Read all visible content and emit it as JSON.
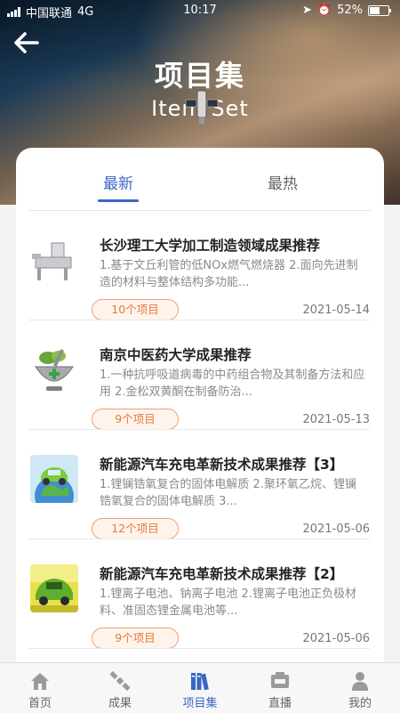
{
  "status_bar": {
    "carrier": "中国联通",
    "network": "4G",
    "time": "10:17",
    "battery": "52%",
    "battery_level": 0.52
  },
  "header": {
    "title": "项目集",
    "subtitle": "Item Set",
    "back_icon": "back-arrow-icon"
  },
  "tabs": [
    {
      "label": "最新",
      "active": true
    },
    {
      "label": "最热",
      "active": false
    }
  ],
  "items": [
    {
      "title": "长沙理工大学加工制造领域成果推荐",
      "desc": "1.基于文丘利管的低NOx燃气燃烧器 2.面向先进制造的材料与整体结构多功能...",
      "count": "10个项目",
      "date": "2021-05-14",
      "thumb": "machinery-thumbnail"
    },
    {
      "title": "南京中医药大学成果推荐",
      "desc": "1.一种抗呼吸道病毒的中药组合物及其制备方法和应用 2.金松双黄酮在制备防治...",
      "count": "9个项目",
      "date": "2021-05-13",
      "thumb": "herbal-mortar-thumbnail"
    },
    {
      "title": "新能源汽车充电革新技术成果推荐【3】",
      "desc": "1.锂镧锆氧复合的固体电解质 2.聚环氧乙烷、锂镧锆氧复合的固体电解质 3...",
      "count": "12个项目",
      "date": "2021-05-06",
      "thumb": "green-car-globe-thumbnail"
    },
    {
      "title": "新能源汽车充电革新技术成果推荐【2】",
      "desc": "1.锂离子电池、钠离子电池 2.锂离子电池正负极材料、准固态锂金属电池等...",
      "count": "9个项目",
      "date": "2021-05-06",
      "thumb": "grass-car-thumbnail"
    }
  ],
  "tabbar": [
    {
      "label": "首页",
      "icon": "home-icon",
      "active": false
    },
    {
      "label": "成果",
      "icon": "satellite-icon",
      "active": false
    },
    {
      "label": "项目集",
      "icon": "books-icon",
      "active": true
    },
    {
      "label": "直播",
      "icon": "live-camera-icon",
      "active": false
    },
    {
      "label": "我的",
      "icon": "user-icon",
      "active": false
    }
  ],
  "colors": {
    "accent": "#3a67c7",
    "badge_text": "#e27a3a",
    "badge_border": "#f0a071",
    "badge_bg": "#fff4ec"
  }
}
